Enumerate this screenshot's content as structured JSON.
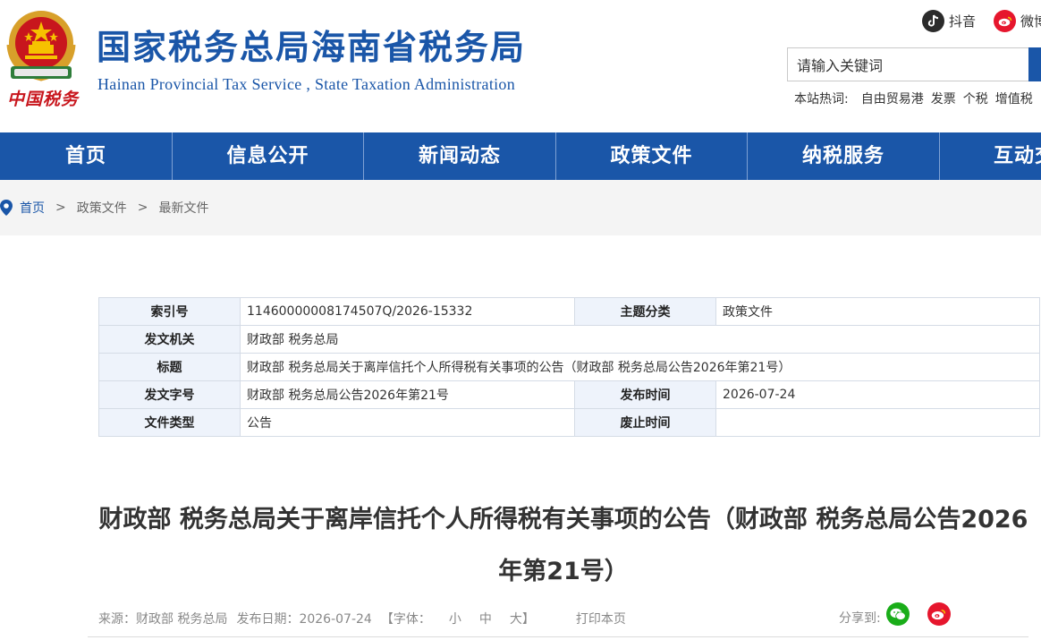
{
  "header": {
    "title": "国家税务总局海南省税务局",
    "subtitle": "Hainan Provincial Tax Service , State Taxation Administration",
    "logo_text": "中国税务",
    "social": [
      {
        "name": "douyin",
        "label": "抖音",
        "color": "#2b2b2b"
      },
      {
        "name": "weibo",
        "label": "微博",
        "color": "#e6162d"
      }
    ],
    "search": {
      "value": "请输入关键词"
    },
    "hot": {
      "label": "本站热词:",
      "items": [
        "自由贸易港",
        "发票",
        "个税",
        "增值税"
      ]
    }
  },
  "nav": {
    "items": [
      "首页",
      "信息公开",
      "新闻动态",
      "政策文件",
      "纳税服务",
      "互动交流"
    ]
  },
  "breadcrumb": {
    "home": "首页",
    "sep": ">",
    "level1": "政策文件",
    "level2": "最新文件"
  },
  "meta": {
    "rows": [
      {
        "k1": "索引号",
        "v1": "11460000008174507Q/2026-15332",
        "k2": "主题分类",
        "v2": "政策文件"
      },
      {
        "k1": "发文机关",
        "v1": "财政部 税务总局"
      },
      {
        "k1": "标题",
        "v1": "财政部 税务总局关于离岸信托个人所得税有关事项的公告（财政部 税务总局公告2026年第21号）"
      },
      {
        "k1": "发文字号",
        "v1": "财政部 税务总局公告2026年第21号",
        "k2": "发布时间",
        "v2": "2026-07-24"
      },
      {
        "k1": "文件类型",
        "v1": "公告",
        "k2": "废止时间",
        "v2": ""
      }
    ]
  },
  "article": {
    "title": "财政部 税务总局关于离岸信托个人所得税有关事项的公告（财政部 税务总局公告2026年第21号）",
    "source": "来源：财政部 税务总局",
    "date": "发布日期：2026-07-24",
    "font_label": "【字体：",
    "font_small": "小",
    "font_medium": "中",
    "font_large": "大】",
    "print": "打印本页",
    "share_label": "分享到:"
  },
  "colors": {
    "brand_blue": "#1a56a8",
    "wechat_green": "#1aad19",
    "weibo_red": "#e6162d"
  }
}
